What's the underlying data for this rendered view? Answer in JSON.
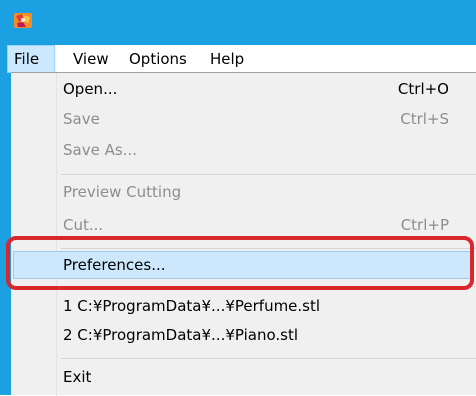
{
  "colors": {
    "titlebar": "#1ba1e2",
    "menu_background": "#f0f0f0",
    "highlight": "#cde8fc",
    "callout": "#d9272e",
    "disabled_text": "#8d8d8d"
  },
  "titlebar": {
    "icon": "app-logo-icon"
  },
  "menubar": {
    "items": [
      {
        "label": "File"
      },
      {
        "label": "View"
      },
      {
        "label": "Options"
      },
      {
        "label": "Help"
      }
    ],
    "active": "File"
  },
  "file_menu": {
    "items": [
      {
        "label": "Open...",
        "shortcut": "Ctrl+O",
        "enabled": true
      },
      {
        "label": "Save",
        "shortcut": "Ctrl+S",
        "enabled": false
      },
      {
        "label": "Save As...",
        "shortcut": "",
        "enabled": false
      },
      {
        "label": "Preview Cutting",
        "shortcut": "",
        "enabled": false
      },
      {
        "label": "Cut...",
        "shortcut": "Ctrl+P",
        "enabled": false
      },
      {
        "label": "Preferences...",
        "shortcut": "",
        "enabled": true,
        "highlighted": true
      },
      {
        "label": "1 C:¥ProgramData¥...¥Perfume.stl",
        "shortcut": "",
        "enabled": true
      },
      {
        "label": "2 C:¥ProgramData¥...¥Piano.stl",
        "shortcut": "",
        "enabled": true
      },
      {
        "label": "Exit",
        "shortcut": "",
        "enabled": true
      }
    ]
  }
}
